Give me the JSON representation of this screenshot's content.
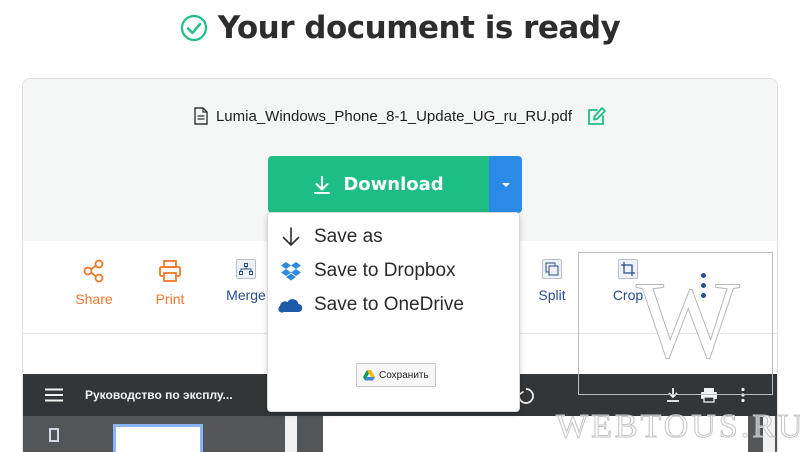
{
  "header": {
    "title": "Your document is ready"
  },
  "file": {
    "name": "Lumia_Windows_Phone_8-1_Update_UG_ru_RU.pdf"
  },
  "download": {
    "label": "Download"
  },
  "dropdown": {
    "items": [
      {
        "label": "Save as",
        "icon": "download-arrow-icon"
      },
      {
        "label": "Save to Dropbox",
        "icon": "dropbox-icon"
      },
      {
        "label": "Save to OneDrive",
        "icon": "onedrive-icon"
      }
    ],
    "save_button": "Сохранить"
  },
  "tools": [
    {
      "label": "Share",
      "icon": "share-icon",
      "color": "#f0772a"
    },
    {
      "label": "Print",
      "icon": "printer-icon",
      "color": "#f0772a"
    },
    {
      "label": "Merge",
      "icon": "merge-icon",
      "color": "#2a4e8a"
    },
    {
      "label": "Split",
      "icon": "split-icon",
      "color": "#2a4e8a"
    },
    {
      "label": "Crop",
      "icon": "crop-icon",
      "color": "#2a4e8a"
    }
  ],
  "viewer": {
    "title": "Руководство по эксплу..."
  },
  "watermark": {
    "letter": "W",
    "text": "WEBTOUS.RU"
  },
  "colors": {
    "download_green": "#1dbe83",
    "caret_blue": "#2b8ae6",
    "orange": "#f0772a",
    "navy": "#2a4e8a",
    "check_green": "#1dbe83"
  }
}
